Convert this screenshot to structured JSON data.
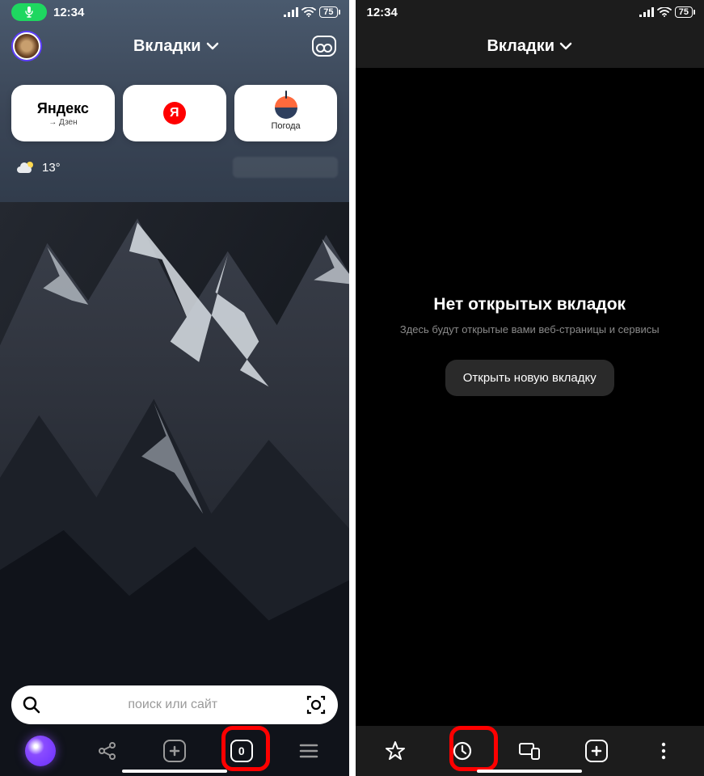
{
  "status": {
    "time": "12:34",
    "battery": "75"
  },
  "header": {
    "title": "Вкладки"
  },
  "tiles": [
    {
      "main": "Яндекс",
      "sub": "→ Дзен"
    },
    {
      "sub": ""
    },
    {
      "sub": "Погода"
    }
  ],
  "weather": {
    "temp": "13°"
  },
  "search": {
    "placeholder": "поиск или сайт"
  },
  "tabCount": "0",
  "empty": {
    "title": "Нет открытых вкладок",
    "subtitle": "Здесь будут открытые вами веб-страницы и сервисы",
    "button": "Открыть новую вкладку"
  }
}
